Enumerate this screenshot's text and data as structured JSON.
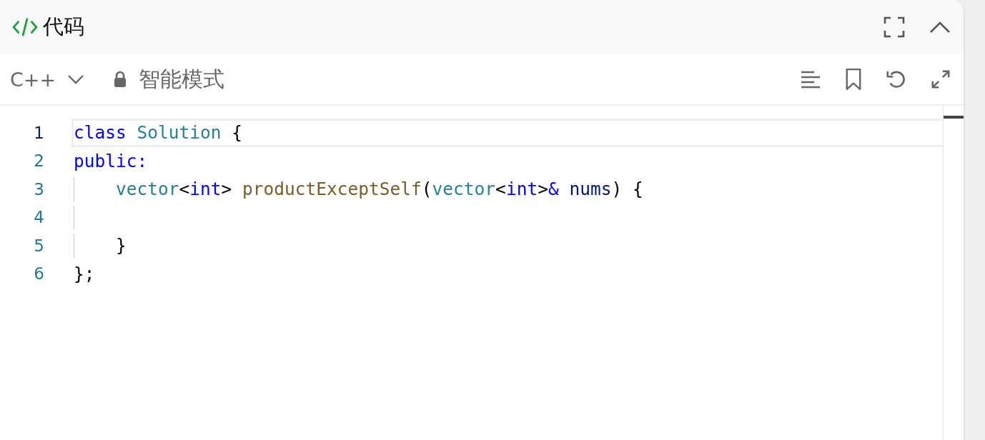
{
  "panel": {
    "title": "代码"
  },
  "toolbar": {
    "language": "C++",
    "mode": "智能模式"
  },
  "editor": {
    "lines": [
      {
        "number": "1",
        "selected": true,
        "indent_guide": false,
        "tokens": [
          {
            "kind": "keyword",
            "text": "class "
          },
          {
            "kind": "type",
            "text": "Solution "
          },
          {
            "kind": "plain",
            "text": "{"
          }
        ]
      },
      {
        "number": "2",
        "selected": false,
        "indent_guide": false,
        "tokens": [
          {
            "kind": "keyword",
            "text": "public:"
          }
        ]
      },
      {
        "number": "3",
        "selected": false,
        "indent_guide": true,
        "tokens": [
          {
            "kind": "type",
            "text": "vector"
          },
          {
            "kind": "plain",
            "text": "<"
          },
          {
            "kind": "keyword",
            "text": "int"
          },
          {
            "kind": "plain",
            "text": "> "
          },
          {
            "kind": "func",
            "text": "productExceptSelf"
          },
          {
            "kind": "plain",
            "text": "("
          },
          {
            "kind": "type",
            "text": "vector"
          },
          {
            "kind": "plain",
            "text": "<"
          },
          {
            "kind": "keyword",
            "text": "int"
          },
          {
            "kind": "plain",
            "text": ">"
          },
          {
            "kind": "keyword",
            "text": "& "
          },
          {
            "kind": "param",
            "text": "nums"
          },
          {
            "kind": "plain",
            "text": ") {"
          }
        ]
      },
      {
        "number": "4",
        "selected": false,
        "indent_guide": true
      },
      {
        "number": "5",
        "selected": false,
        "indent_guide": true,
        "tokens": [
          {
            "kind": "plain",
            "text": "}"
          }
        ]
      },
      {
        "number": "6",
        "selected": false,
        "indent_guide": false,
        "tokens": [
          {
            "kind": "plain",
            "text": "};"
          }
        ]
      }
    ]
  }
}
